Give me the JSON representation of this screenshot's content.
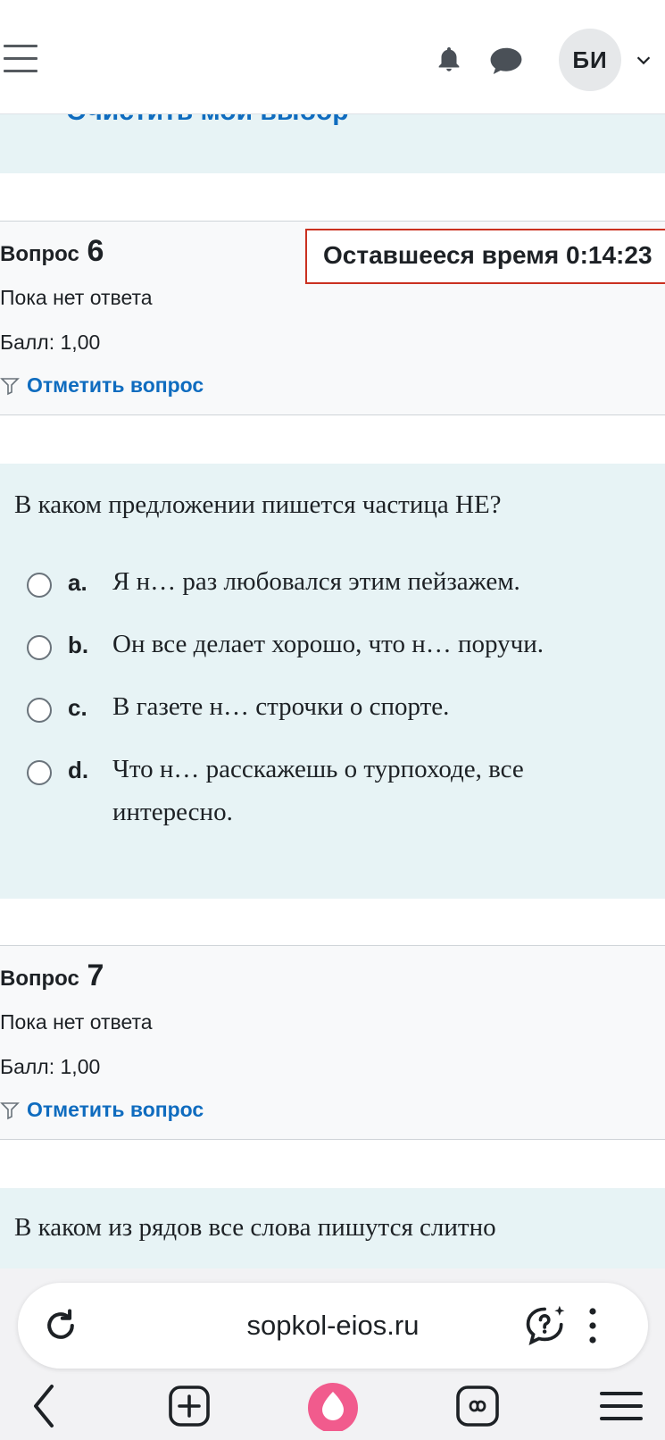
{
  "header": {
    "menu_icon": "hamburger-menu-icon",
    "notifications_icon": "bell-icon",
    "messages_icon": "chat-bubble-icon",
    "avatar_initials": "БИ",
    "avatar_caret_icon": "chevron-down-icon"
  },
  "previous_question": {
    "clear_choice_label": "Очистить мой выбор"
  },
  "timer": {
    "label": "Оставшееся время 0:14:23"
  },
  "questions": [
    {
      "label": "Вопрос",
      "number": "6",
      "state": "Пока нет ответа",
      "grade": "Балл: 1,00",
      "flag_label": "Отметить вопрос",
      "text": "В каком предложении пишется частица НЕ?",
      "answers": [
        {
          "letter": "a.",
          "text": "Я н… раз любовался этим пейзажем."
        },
        {
          "letter": "b.",
          "text": "Он все делает хорошо, что н… поручи."
        },
        {
          "letter": "c.",
          "text": "В газете н… строчки о спорте."
        },
        {
          "letter": "d.",
          "text": "Что н… расскажешь о турпоходе, все интересно."
        }
      ]
    },
    {
      "label": "Вопрос",
      "number": "7",
      "state": "Пока нет ответа",
      "grade": "Балл: 1,00",
      "flag_label": "Отметить вопрос",
      "text": "В каком из рядов все слова пишутся слитно"
    }
  ],
  "browser": {
    "url": "sopkol-eios.ru",
    "reload_icon": "reload-icon",
    "assistant_icon": "ai-question-icon",
    "more_icon": "more-vertical-icon",
    "nav": {
      "back_icon": "back-arrow-icon",
      "new_tab_icon": "plus-square-icon",
      "alice_icon": "alice-assistant-icon",
      "tabs_icon": "infinity-tabs-icon",
      "menu_icon": "hamburger-menu-icon"
    }
  },
  "colors": {
    "link": "#0f6cbf",
    "timer_border": "#ca3120",
    "content_bg": "#e7f3f5",
    "info_bg": "#f8f9fa",
    "alice": "#f15b8d"
  }
}
